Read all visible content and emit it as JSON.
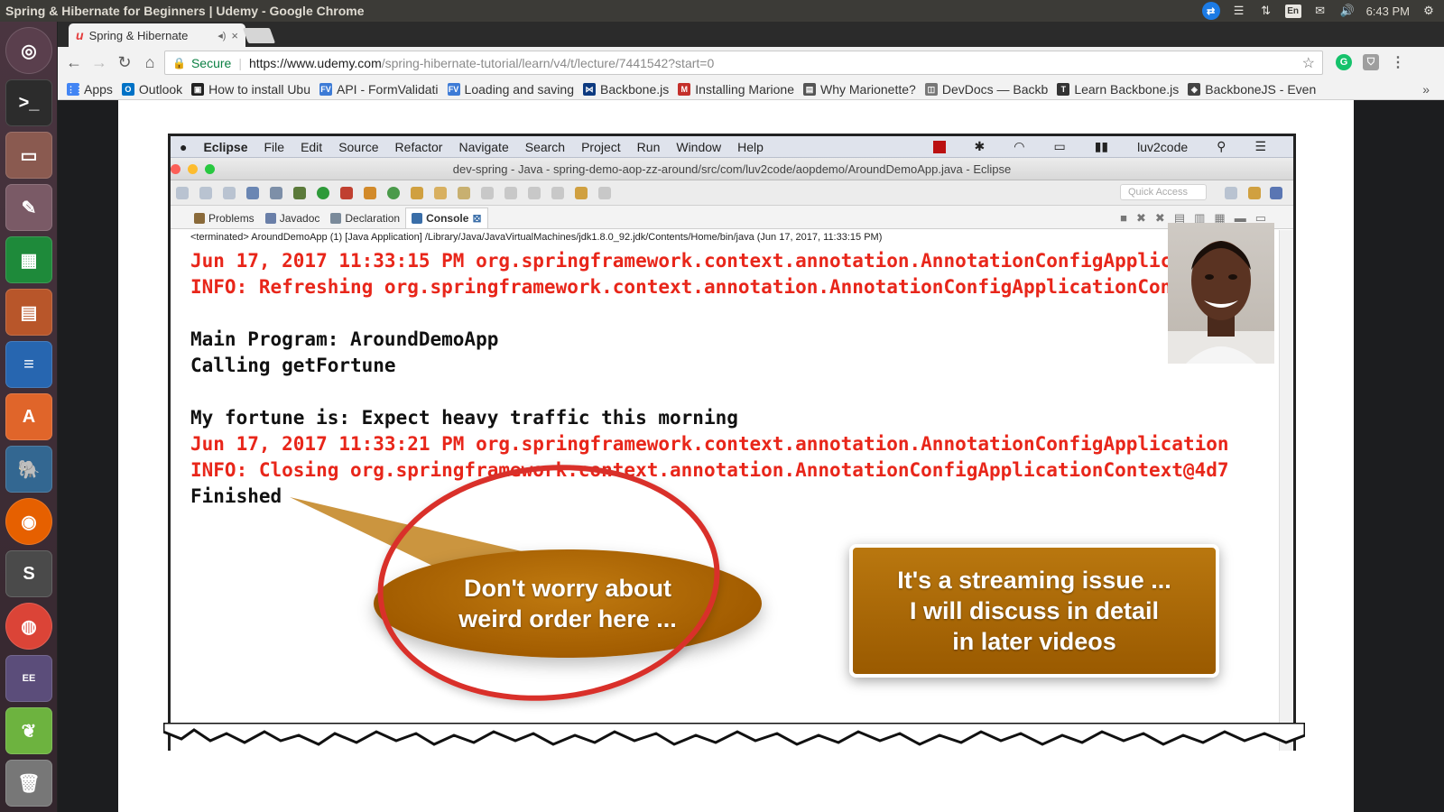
{
  "top_panel": {
    "window_title": "Spring & Hibernate for Beginners | Udemy - Google Chrome",
    "tray_icons": [
      "teamviewer-icon",
      "menu-icon",
      "network-icon",
      "keyboard-icon",
      "mail-icon",
      "volume-icon",
      "settings-icon"
    ],
    "keyboard_layout": "En",
    "clock": "6:43 PM"
  },
  "launcher": {
    "items": [
      "ubuntu-dash",
      "terminal",
      "files",
      "system-settings",
      "libreoffice-calc",
      "libreoffice-impress",
      "libreoffice-writer",
      "software-center",
      "pgadmin",
      "firefox",
      "sublime-text",
      "chrome",
      "eclipse-java-ee",
      "spring-tool-suite",
      "trash"
    ]
  },
  "chrome": {
    "tab": {
      "title": "Spring & Hibernate",
      "favicon": "udemy-icon"
    },
    "omnibox": {
      "secure_label": "Secure",
      "url_host": "https://www.udemy.com",
      "url_path": "/spring-hibernate-tutorial/learn/v4/t/lecture/7441542?start=0"
    },
    "bookmarks": [
      {
        "label": "Apps",
        "color": "#4285f4",
        "glyph": "⋮⋮"
      },
      {
        "label": "Outlook",
        "color": "#0072c6",
        "glyph": "O"
      },
      {
        "label": "How to install Ubu",
        "color": "#222222",
        "glyph": "▣"
      },
      {
        "label": "API - FormValidati",
        "color": "#3d7bd6",
        "glyph": "FV"
      },
      {
        "label": "Loading and saving",
        "color": "#3d7bd6",
        "glyph": "FV"
      },
      {
        "label": "Backbone.js",
        "color": "#0d3a80",
        "glyph": "⋈"
      },
      {
        "label": "Installing Marione",
        "color": "#c4302b",
        "glyph": "M"
      },
      {
        "label": "Why Marionette?",
        "color": "#555555",
        "glyph": "▤"
      },
      {
        "label": "DevDocs — Backb",
        "color": "#777777",
        "glyph": "◫"
      },
      {
        "label": "Learn Backbone.js",
        "color": "#333333",
        "glyph": "T"
      },
      {
        "label": "BackboneJS - Even",
        "color": "#444444",
        "glyph": "◈"
      }
    ]
  },
  "eclipse": {
    "menubar": [
      "Eclipse",
      "File",
      "Edit",
      "Source",
      "Refactor",
      "Navigate",
      "Search",
      "Project",
      "Run",
      "Window",
      "Help"
    ],
    "menubar_user": "luv2code",
    "window_title": "dev-spring - Java - spring-demo-aop-zz-around/src/com/luv2code/aopdemo/AroundDemoApp.java - Eclipse",
    "quick_access_placeholder": "Quick Access",
    "view_tabs": [
      {
        "label": "Problems",
        "icon": "problems-icon",
        "color": "#8a6a3a"
      },
      {
        "label": "Javadoc",
        "icon": "javadoc-icon",
        "color": "#6a7fa8"
      },
      {
        "label": "Declaration",
        "icon": "declaration-icon",
        "color": "#7a8a9a"
      },
      {
        "label": "Console",
        "icon": "console-icon",
        "color": "#3a6ea8"
      }
    ],
    "terminated_line": "<terminated> AroundDemoApp (1) [Java Application] /Library/Java/JavaVirtualMachines/jdk1.8.0_92.jdk/Contents/Home/bin/java (Jun 17, 2017, 11:33:15 PM)",
    "console_lines": [
      {
        "text": "Jun 17, 2017 11:33:15 PM org.springframework.context.annotation.AnnotationConfigApplication",
        "style": "red"
      },
      {
        "text": "INFO: Refreshing org.springframework.context.annotation.AnnotationConfigApplicationContext@",
        "style": "red"
      },
      {
        "text": "",
        "style": "blk"
      },
      {
        "text": "Main Program: AroundDemoApp",
        "style": "blk"
      },
      {
        "text": "Calling getFortune",
        "style": "blk"
      },
      {
        "text": "",
        "style": "blk"
      },
      {
        "text": "My fortune is: Expect heavy traffic this morning",
        "style": "blk"
      },
      {
        "text": "Jun 17, 2017 11:33:21 PM org.springframework.context.annotation.AnnotationConfigApplication",
        "style": "red"
      },
      {
        "text": "INFO: Closing org.springframework.context.annotation.AnnotationConfigApplicationContext@4d7",
        "style": "red"
      },
      {
        "text": "Finished",
        "style": "blk"
      }
    ]
  },
  "callouts": {
    "left_line1": "Don't worry about",
    "left_line2": "weird order here ...",
    "right_line1": "It's a streaming issue ...",
    "right_line2": "I will discuss in detail",
    "right_line3": "in later videos"
  },
  "colors": {
    "console_red": "#e8261a",
    "callout_brown": "#a25c00",
    "circle_red": "#d9302a",
    "secure_green": "#0b8043"
  }
}
